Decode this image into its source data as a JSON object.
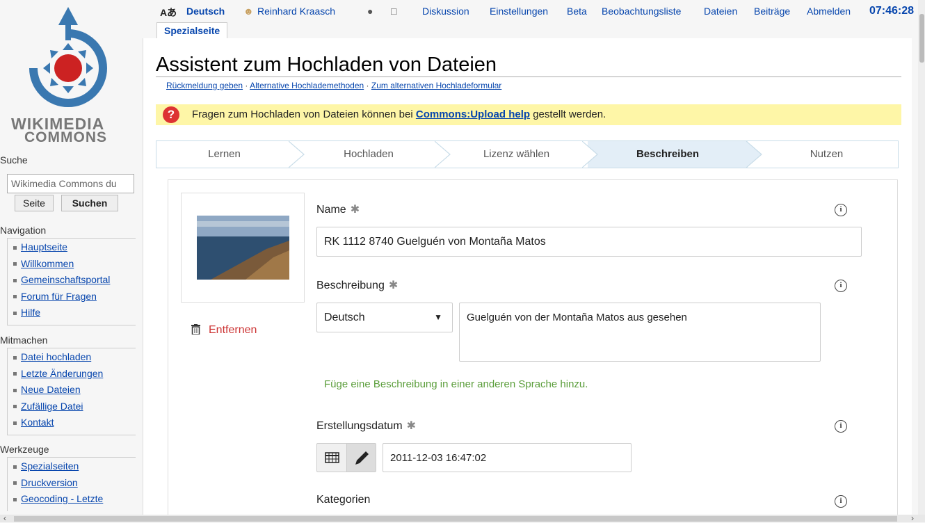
{
  "sidebar": {
    "logo_line1": "WIKIMEDIA",
    "logo_line2": "COMMONS",
    "search_heading": "Suche",
    "search_placeholder": "Wikimedia Commons du",
    "btn_page": "Seite",
    "btn_search": "Suchen",
    "nav_heading": "Navigation",
    "nav_items": [
      "Hauptseite",
      "Willkommen",
      "Gemeinschaftsportal",
      "Forum für Fragen",
      "Hilfe"
    ],
    "participate_heading": "Mitmachen",
    "participate_items": [
      "Datei hochladen",
      "Letzte Änderungen",
      "Neue Dateien",
      "Zufällige Datei",
      "Kontakt"
    ],
    "tools_heading": "Werkzeuge",
    "tools_items": [
      "Spezialseiten",
      "Druckversion",
      "Geocoding - Letzte"
    ]
  },
  "topbar": {
    "lang_icon": "Aあ",
    "language": "Deutsch",
    "user": "Reinhard Kraasch",
    "links": [
      "Diskussion",
      "Einstellungen",
      "Beta",
      "Beobachtungsliste",
      "Dateien",
      "Beiträge",
      "Abmelden"
    ],
    "clock": "07:46:28",
    "tab": "Spezialseite"
  },
  "page": {
    "title": "Assistent zum Hochladen von Dateien",
    "subtitle_links": [
      "Rückmeldung geben",
      "Alternative Hochlademethoden",
      "Zum alternativen Hochladeformular"
    ],
    "notice_before": "Fragen zum Hochladen von Dateien können bei ",
    "notice_link": "Commons:Upload help",
    "notice_after": " gestellt werden."
  },
  "steps": [
    "Lernen",
    "Hochladen",
    "Lizenz wählen",
    "Beschreiben",
    "Nutzen"
  ],
  "active_step": "Beschreiben",
  "form": {
    "remove_label": "Entfernen",
    "name_label": "Name",
    "name_value": "RK 1112 8740 Guelguén von Montaña Matos",
    "desc_label": "Beschreibung",
    "desc_language": "Deutsch",
    "desc_value": "Guelguén von der Montaña Matos aus gesehen",
    "add_language": "Füge eine Beschreibung in einer anderen Sprache hinzu.",
    "date_label": "Erstellungsdatum",
    "date_value": "2011-12-03 16:47:02",
    "categories_label": "Kategorien",
    "required_mark": "✱",
    "info_mark": "i"
  }
}
